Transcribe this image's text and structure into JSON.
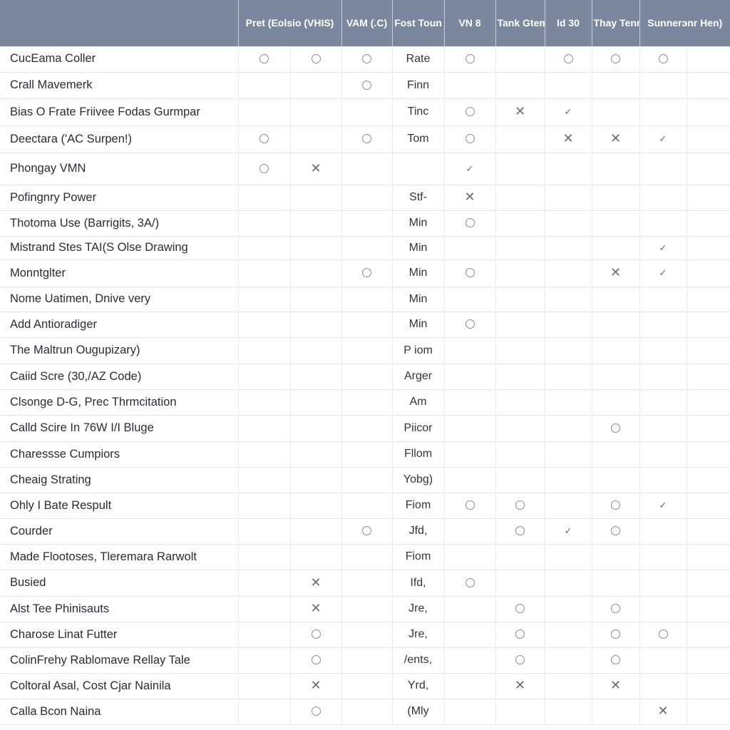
{
  "header": {
    "columns": [
      {
        "label": "",
        "span": 1
      },
      {
        "label": "Pret (Eolsio (VHIS)",
        "span": 2
      },
      {
        "label": "VAM (.C)",
        "span": 1
      },
      {
        "label": "Fost Toun",
        "span": 1
      },
      {
        "label": "VN 8",
        "span": 1
      },
      {
        "label": "Tank Gtemer)",
        "span": 1
      },
      {
        "label": "Id 30",
        "span": 1
      },
      {
        "label": "Thay Tenme)",
        "span": 1
      },
      {
        "label": "Sunnerэnr Hen)",
        "span": 2
      }
    ]
  },
  "colors": {
    "header_bg": "#7a879f",
    "header_text": "#ffffff",
    "grid": "#e6e6ea",
    "marker": "#8a8a92"
  },
  "marker_legend": {
    "o": "circle-icon",
    "x": "cross-icon",
    "c": "check-icon"
  },
  "rows": [
    {
      "name": "CucEama Coller",
      "cells": [
        "o",
        "o",
        "o",
        "Rate",
        "o",
        "",
        "o",
        "o",
        "o",
        ""
      ]
    },
    {
      "name": "Crall Mavemerk",
      "cells": [
        "",
        "",
        "o",
        "Finn",
        "",
        "",
        "",
        "",
        "",
        ""
      ]
    },
    {
      "name": "Bias O Frate Friivee Fodas Gurmpar",
      "cells": [
        "",
        "",
        "",
        "Tinc",
        "o",
        "x",
        "c",
        "",
        "",
        ""
      ]
    },
    {
      "name": "Deectara ('AC Surpen!)",
      "cells": [
        "o",
        "",
        "o",
        "Tom",
        "o",
        "",
        "x",
        "x",
        "c",
        ""
      ]
    },
    {
      "name": "Phongay VMN",
      "cells": [
        "o",
        "x",
        "",
        "",
        "c",
        "",
        "",
        "",
        "",
        ""
      ]
    },
    {
      "name": "Pofingnry Power",
      "cells": [
        "",
        "",
        "",
        "Stf-",
        "x",
        "",
        "",
        "",
        "",
        ""
      ]
    },
    {
      "name": "Thotoma Use (Barrigits, 3A/)",
      "cells": [
        "",
        "",
        "",
        "Min",
        "o",
        "",
        "",
        "",
        "",
        ""
      ]
    },
    {
      "name": "Mistrand Stes TAI(S Olse Drawing",
      "cells": [
        "",
        "",
        "",
        "Min",
        "",
        "",
        "",
        "",
        "c",
        ""
      ]
    },
    {
      "name": "Monntglter",
      "cells": [
        "",
        "",
        "o",
        "Min",
        "o",
        "",
        "",
        "x",
        "c",
        ""
      ]
    },
    {
      "name": "Nome Uatimen, Dnive very",
      "cells": [
        "",
        "",
        "",
        "Min",
        "",
        "",
        "",
        "",
        "",
        ""
      ]
    },
    {
      "name": "Add Antioradiger",
      "cells": [
        "",
        "",
        "",
        "Min",
        "o",
        "",
        "",
        "",
        "",
        ""
      ]
    },
    {
      "name": "The Maltrun Ougupizary)",
      "cells": [
        "",
        "",
        "",
        "P iom",
        "",
        "",
        "",
        "",
        "",
        ""
      ]
    },
    {
      "name": "Caiid Scre (30,/AZ Code)",
      "cells": [
        "",
        "",
        "",
        "Arger",
        "",
        "",
        "",
        "",
        "",
        ""
      ]
    },
    {
      "name": "Clsonge D-G, Prec Thrmcitation",
      "cells": [
        "",
        "",
        "",
        "Am",
        "",
        "",
        "",
        "",
        "",
        ""
      ]
    },
    {
      "name": "Calld Scire In 76W I/I Bluge",
      "cells": [
        "",
        "",
        "",
        "Piicor",
        "",
        "",
        "",
        "o",
        "",
        ""
      ]
    },
    {
      "name": "Charessse Cumpiors",
      "cells": [
        "",
        "",
        "",
        "Fllom",
        "",
        "",
        "",
        "",
        "",
        ""
      ]
    },
    {
      "name": "Cheaig Strating",
      "cells": [
        "",
        "",
        "",
        "Yobg)",
        "",
        "",
        "",
        "",
        "",
        ""
      ]
    },
    {
      "name": "Ohly I Bate Respult",
      "cells": [
        "",
        "",
        "",
        "Fiom",
        "o",
        "o",
        "",
        "o",
        "c",
        ""
      ]
    },
    {
      "name": "Courder",
      "cells": [
        "",
        "",
        "o",
        "Jfd,",
        "",
        "o",
        "c",
        "o",
        "",
        ""
      ]
    },
    {
      "name": "Made Flootoses, Tleremara Rarwolt",
      "cells": [
        "",
        "",
        "",
        "Fiom",
        "",
        "",
        "",
        "",
        "",
        ""
      ]
    },
    {
      "name": "Busied",
      "cells": [
        "",
        "x",
        "",
        "Ifd,",
        "o",
        "",
        "",
        "",
        "",
        ""
      ]
    },
    {
      "name": "Alst Tee Phinisauts",
      "cells": [
        "",
        "x",
        "",
        "Jre,",
        "",
        "o",
        "",
        "o",
        "",
        ""
      ]
    },
    {
      "name": "Charose Linat Futter",
      "cells": [
        "",
        "o",
        "",
        "Jre,",
        "",
        "o",
        "",
        "o",
        "o",
        ""
      ]
    },
    {
      "name": "ColinFrehy Rablomave Rellay Tale",
      "cells": [
        "",
        "o",
        "",
        "/ents,",
        "",
        "o",
        "",
        "o",
        "",
        ""
      ]
    },
    {
      "name": "Coltoral Asal, Cost Cjar Nainila",
      "cells": [
        "",
        "x",
        "",
        "Yrd,",
        "",
        "x",
        "",
        "x",
        "",
        ""
      ]
    },
    {
      "name": "Calla Bcon Naina",
      "cells": [
        "",
        "o",
        "",
        "(Mly",
        "",
        "",
        "",
        "",
        "x",
        ""
      ]
    }
  ]
}
